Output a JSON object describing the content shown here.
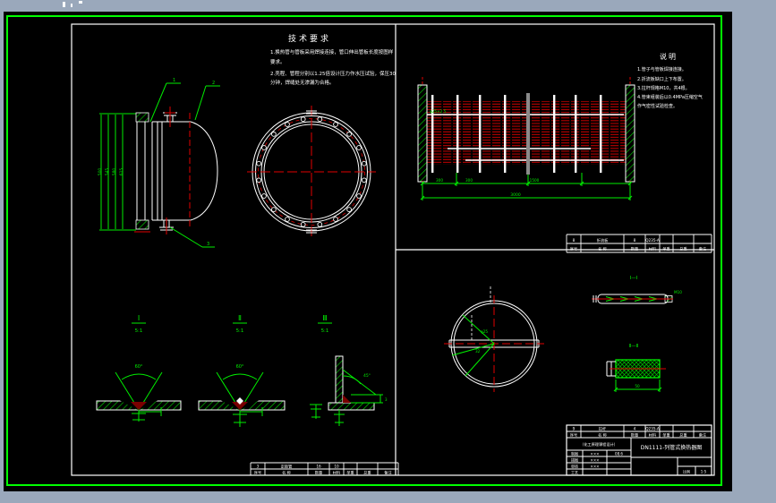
{
  "colors": {
    "desktop": "#9aa8bb",
    "canvas": "#000000",
    "frame_green": "#00ff00",
    "line_white": "#ffffff",
    "tube_red": "#e00000",
    "weld_red": "#7a0000",
    "center_gray": "#8a8a8a"
  },
  "notes_left": {
    "title": "技术要求",
    "lines": [
      "1.换热管与管板采用焊接连接，管口伸出管板长度按图样",
      "   要求。",
      "2.壳程、管程分别以1.25倍设计压力作水压试验，保压30",
      "   分钟，焊缝处无渗漏为合格。"
    ]
  },
  "notes_right": {
    "title": "说明",
    "lines": [
      "1.管子与管板焊接连接。",
      "2.折流板缺口上下布置。",
      "3.拉杆规格M10，共4根。",
      "4.管束组装后以0.4MPa压缩空气",
      "   作气密性试验检查。"
    ]
  },
  "vessel_view": {
    "dims": [
      "500",
      "545",
      "580",
      "615"
    ],
    "callouts": [
      "1",
      "2",
      "3"
    ]
  },
  "bundle": {
    "tube_label": "φ25×2.5",
    "dims": [
      "300",
      "300",
      "1500"
    ],
    "total_dim": "3000"
  },
  "weld_details": [
    {
      "numeral": "Ⅰ",
      "scale": "5:1",
      "angle": "60°"
    },
    {
      "numeral": "Ⅱ",
      "scale": "5:1",
      "angle": "60°"
    },
    {
      "numeral": "Ⅲ",
      "scale": "5:1",
      "angle": "45°",
      "leg": "3"
    }
  ],
  "sections": {
    "rod": {
      "label": "Ⅰ—Ⅰ",
      "thread": "M10"
    },
    "spacer": {
      "label": "Ⅱ—Ⅱ",
      "dim": "50"
    }
  },
  "sheet_detail": {
    "hole": "φ25",
    "pitch": "32"
  },
  "bom_header": [
    "序号",
    "名  称",
    "数量",
    "材料",
    "单重",
    "总重",
    "备注"
  ],
  "bom_rows": {
    "mid": [
      "8",
      "折流板",
      "8",
      "Q235-A",
      "",
      "",
      ""
    ],
    "bottom": [
      "3",
      "定距管",
      "16",
      "10",
      "",
      "",
      ""
    ],
    "title_strip": [
      "9",
      "拉杆",
      "4",
      "Q235-A",
      "",
      "",
      ""
    ]
  },
  "title_block": {
    "company": "（化工原理课程设计）",
    "rows": [
      {
        "label": "制图",
        "name": "×××",
        "date": "08.6"
      },
      {
        "label": "描图",
        "name": "×××",
        "date": ""
      },
      {
        "label": "审核",
        "name": "×××",
        "date": ""
      },
      {
        "label": "工艺",
        "name": "",
        "date": ""
      }
    ],
    "drawing_title": "DN1111-列管式换热器图",
    "scale_label": "比例",
    "scale_value": "1:5"
  }
}
